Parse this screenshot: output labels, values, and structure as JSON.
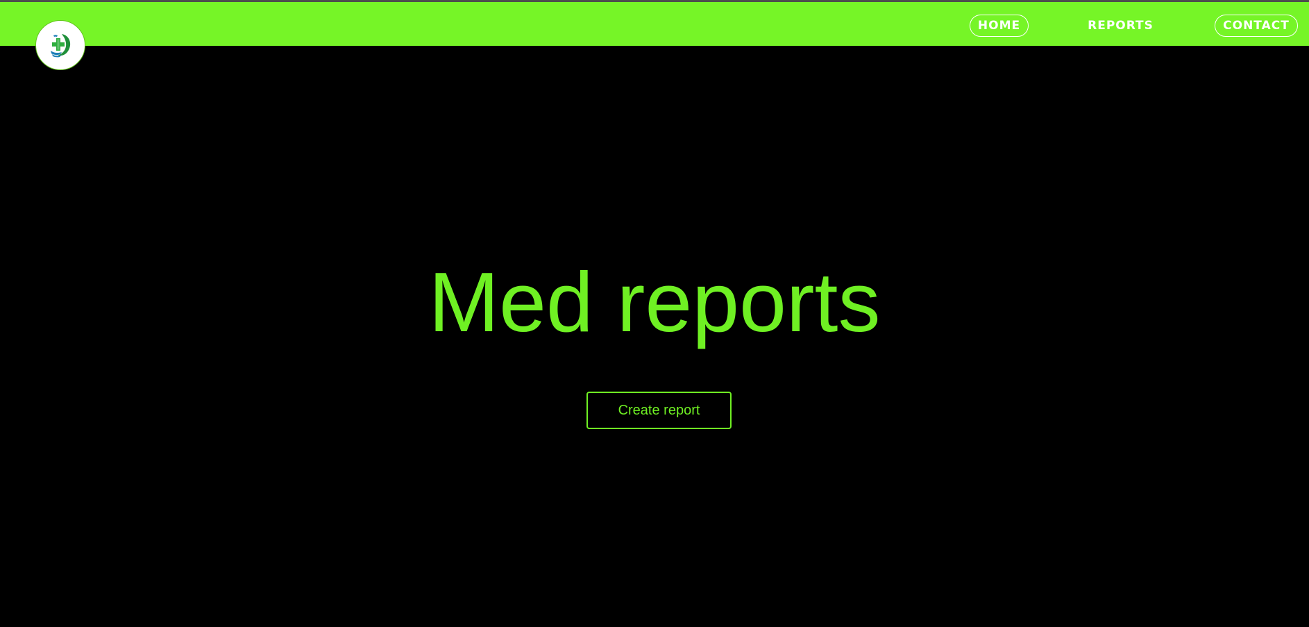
{
  "header": {
    "logo_icon": "medical-cross-hands-logo-icon",
    "nav": [
      {
        "label": "HOME",
        "style": "outlined"
      },
      {
        "label": "REPORTS",
        "style": "plain"
      },
      {
        "label": "CONTACT",
        "style": "outlined"
      }
    ]
  },
  "hero": {
    "title": "Med reports",
    "cta_label": "Create report"
  },
  "colors": {
    "navbar_bg": "#76f527",
    "page_bg": "#000000",
    "accent": "#6ff023",
    "nav_text": "#ffffff"
  }
}
